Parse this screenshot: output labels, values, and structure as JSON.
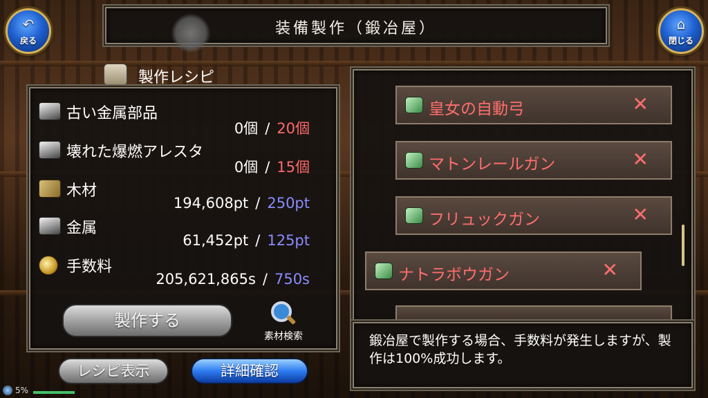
{
  "header": {
    "title": "装備製作（鍛冶屋）",
    "back_label": "戻る",
    "close_label": "閉じる"
  },
  "recipe": {
    "heading": "製作レシピ",
    "materials": [
      {
        "name": "古い金属部品",
        "icon": "metal-ingot-icon",
        "owned": "0個",
        "required": "20個",
        "required_color": "#ff6a6a"
      },
      {
        "name": "壊れた爆燃アレスタ",
        "icon": "metal-ingot-icon",
        "owned": "0個",
        "required": "15個",
        "required_color": "#ff6a6a"
      },
      {
        "name": "木材",
        "icon": "wood-icon",
        "owned": "194,608pt",
        "required": "250pt",
        "required_color": "#8a8cff"
      },
      {
        "name": "金属",
        "icon": "metal-ingot-icon",
        "owned": "61,452pt",
        "required": "125pt",
        "required_color": "#8a8cff"
      },
      {
        "name": "手数料",
        "icon": "coin-icon",
        "owned": "205,621,865s",
        "required": "750s",
        "required_color": "#8a8cff"
      }
    ],
    "separator": "/",
    "craft_button": "製作する",
    "search_label": "素材検索",
    "recipe_view_button": "レシピ表示",
    "detail_button": "詳細確認"
  },
  "weapon_list": [
    {
      "name": "皇女の自動弓"
    },
    {
      "name": "マトンレールガン"
    },
    {
      "name": "フリュックガン"
    },
    {
      "name": "ナトラボウガン"
    }
  ],
  "message": "鍛冶屋で製作する場合、手数料が発生しますが、製作は100%成功します。",
  "status": {
    "battery": "5%"
  }
}
